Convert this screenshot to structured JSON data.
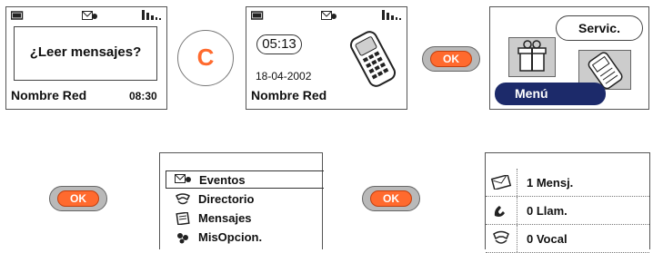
{
  "screen1": {
    "message": "¿Leer mensajes?",
    "network": "Nombre Red",
    "time": "08:30"
  },
  "c_button": {
    "label": "C"
  },
  "screen2": {
    "clock": "05:13",
    "date": "18-04-2002",
    "network": "Nombre Red"
  },
  "ok_button": {
    "label": "OK"
  },
  "screen3": {
    "services_label": "Servic.",
    "menu_label": "Menú"
  },
  "menu_list": {
    "items": [
      {
        "label": "Eventos",
        "icon": "events-icon"
      },
      {
        "label": "Directorio",
        "icon": "directory-icon"
      },
      {
        "label": "Mensajes",
        "icon": "messages-icon"
      },
      {
        "label": "MisOpcion.",
        "icon": "options-icon"
      }
    ]
  },
  "events_list": {
    "items": [
      {
        "label": "1 Mensj.",
        "icon": "message-icon"
      },
      {
        "label": "0 Llam.",
        "icon": "phone-call-icon"
      },
      {
        "label": "0 Vocal",
        "icon": "voicemail-icon"
      }
    ]
  },
  "colors": {
    "accent": "#ff6a2e",
    "menu_tab": "#1c2a6a"
  }
}
